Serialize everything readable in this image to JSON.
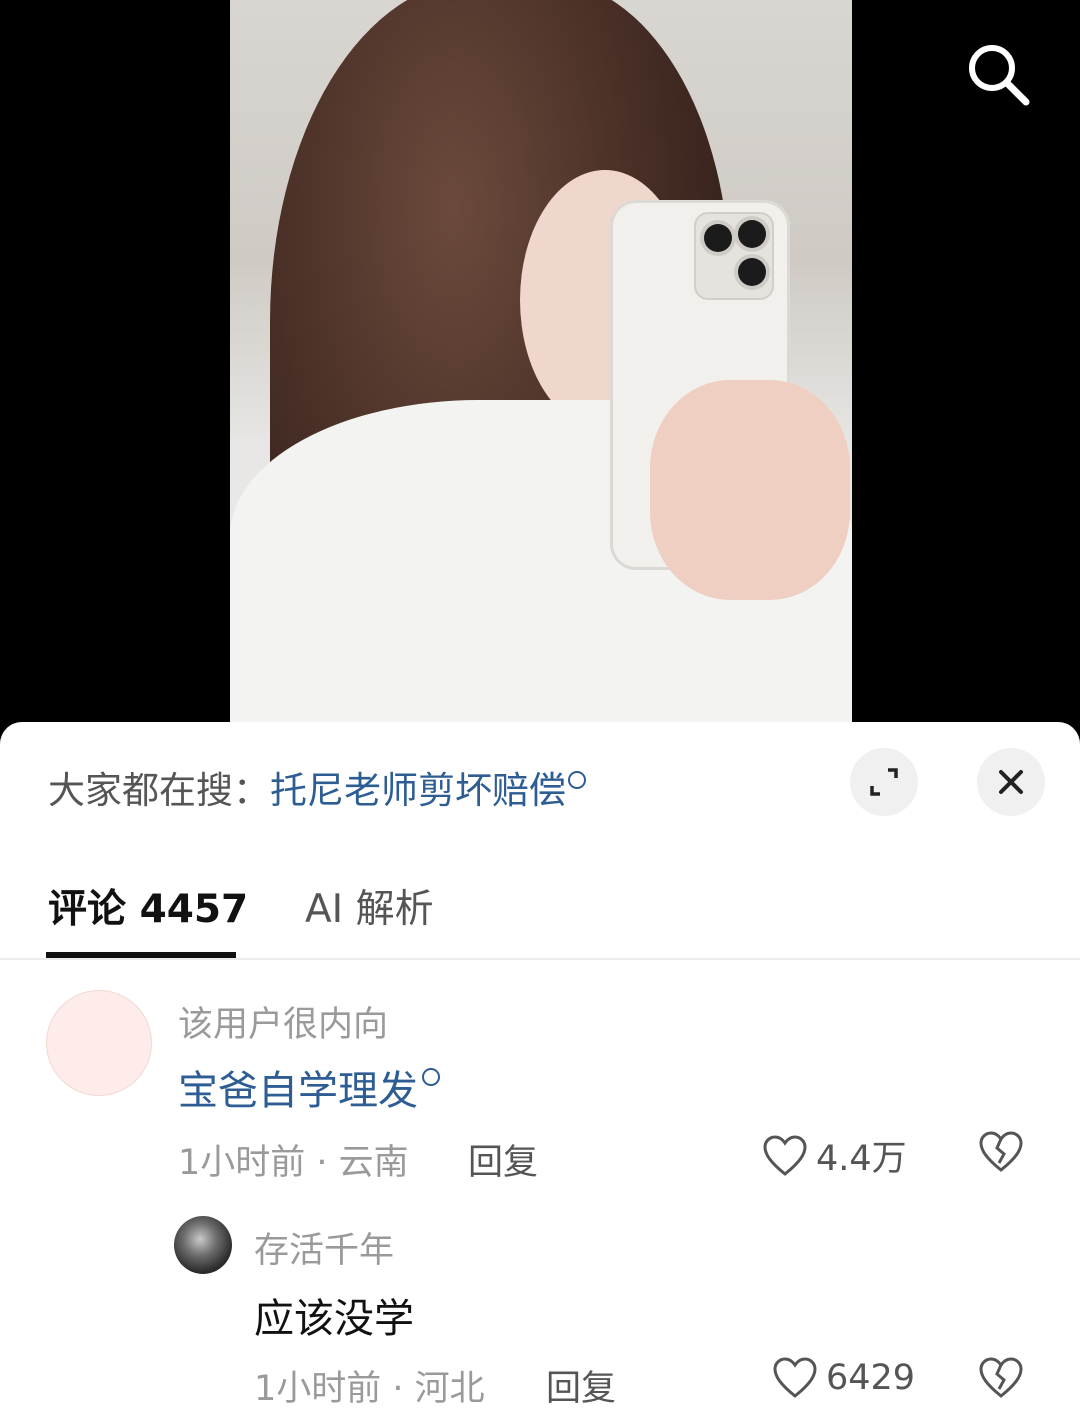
{
  "video": {
    "search_icon": "search-icon"
  },
  "trending": {
    "prefix": "大家都在搜：",
    "query": "托尼老师剪坏赔偿",
    "expand_icon": "expand-icon",
    "close_icon": "close-icon"
  },
  "tabs": [
    {
      "label": "评论 4457",
      "active": true
    },
    {
      "label": "AI 解析",
      "active": false
    }
  ],
  "comments": [
    {
      "user": "该用户很内向",
      "text": "宝爸自学理发",
      "text_is_search_link": true,
      "time_location": "1小时前 · 云南",
      "reply_label": "回复",
      "likes": "4.4万"
    },
    {
      "user": "存活千年",
      "text": "应该没学",
      "text_is_search_link": false,
      "time_location": "1小时前 · 河北",
      "reply_label": "回复",
      "likes": "6429"
    }
  ],
  "colors": {
    "link": "#2e5d94",
    "muted": "#9a9a9a",
    "active_tab_underline": "#111111"
  }
}
